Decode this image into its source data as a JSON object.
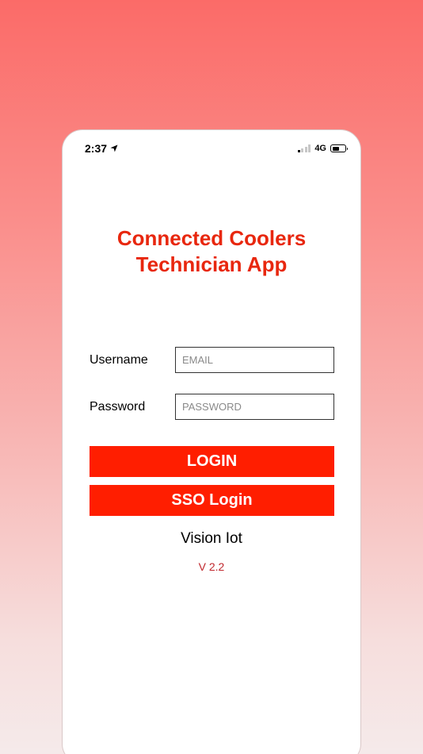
{
  "status_bar": {
    "time": "2:37",
    "network": "4G",
    "signal_bars_active": 1,
    "signal_bars_total": 4,
    "battery_level": 0.55,
    "location_icon": "location-arrow-icon"
  },
  "title": {
    "line1": "Connected Coolers",
    "line2": "Technician App"
  },
  "form": {
    "username_label": "Username",
    "username_placeholder": "EMAIL",
    "username_value": "",
    "password_label": "Password",
    "password_placeholder": "PASSWORD",
    "password_value": ""
  },
  "buttons": {
    "login_label": "LOGIN",
    "sso_label": "SSO Login"
  },
  "footer": {
    "brand": "Vision Iot",
    "version": "V 2.2"
  },
  "colors": {
    "accent": "#ff1e00",
    "title": "#e8270e",
    "version": "#c0272d"
  }
}
